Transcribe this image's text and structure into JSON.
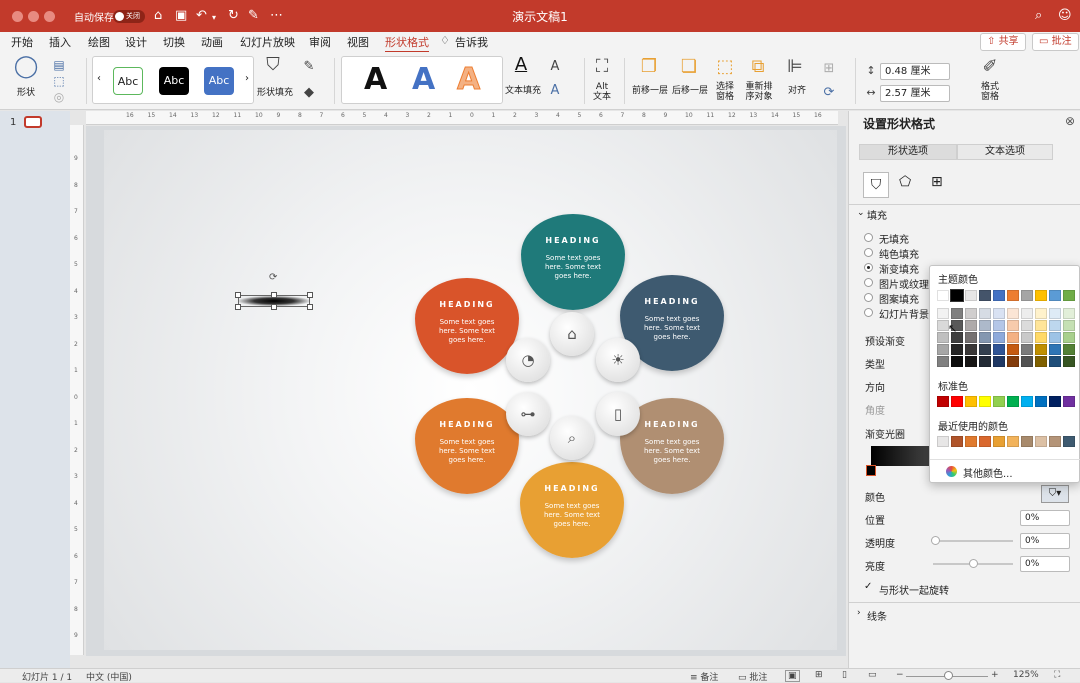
{
  "window": {
    "title": "演示文稿1",
    "autosave_label": "自动保存",
    "autosave_state": "关闭"
  },
  "tabs": [
    "开始",
    "插入",
    "绘图",
    "设计",
    "切换",
    "动画",
    "幻灯片放映",
    "审阅",
    "视图",
    "形状格式",
    "告诉我"
  ],
  "active_tab": "形状格式",
  "top_buttons": {
    "share": "共享",
    "comments": "批注"
  },
  "ribbon": {
    "shape_label": "形状",
    "style_samples": [
      "Abc",
      "Abc",
      "Abc"
    ],
    "shape_fill_label": "形状填充",
    "wordart_samples": [
      "A",
      "A",
      "A"
    ],
    "text_fill_label": "文本填充",
    "alt_text_label": "Alt\n文本",
    "bring_forward": "前移一层",
    "send_backward": "后移一层",
    "selection_pane": "选择\n窗格",
    "reorder": "重新排\n序对象",
    "align": "对齐",
    "height": "0.48 厘米",
    "width": "2.57 厘米",
    "format_pane": "格式\n窗格"
  },
  "slide_panel": {
    "number": "1"
  },
  "ruler_h": [
    "16",
    "15",
    "14",
    "13",
    "12",
    "11",
    "10",
    "9",
    "8",
    "7",
    "6",
    "5",
    "4",
    "3",
    "2",
    "1",
    "0",
    "1",
    "2",
    "3",
    "4",
    "5",
    "6",
    "7",
    "8",
    "9",
    "10",
    "11",
    "12",
    "13",
    "14",
    "15",
    "16"
  ],
  "ruler_v": [
    "9",
    "8",
    "7",
    "6",
    "5",
    "4",
    "3",
    "2",
    "1",
    "0",
    "1",
    "2",
    "3",
    "4",
    "5",
    "6",
    "7",
    "8",
    "9"
  ],
  "petals": [
    {
      "heading": "HEADING",
      "text": "Some text goes here. Some text goes here.",
      "color": "#1f7a7a",
      "icon": "house-icon"
    },
    {
      "heading": "HEADING",
      "text": "Some text goes here. Some text goes here.",
      "color": "#3e5a70",
      "icon": "lightbulb-icon"
    },
    {
      "heading": "HEADING",
      "text": "Some text goes here. Some text goes here.",
      "color": "#b08f72",
      "icon": "book-icon"
    },
    {
      "heading": "HEADING",
      "text": "Some text goes here. Some text goes here.",
      "color": "#e8a033",
      "icon": "search-icon"
    },
    {
      "heading": "HEADING",
      "text": "Some text goes here. Some text goes here.",
      "color": "#e07a2e",
      "icon": "hierarchy-icon"
    },
    {
      "heading": "HEADING",
      "text": "Some text goes here. Some text goes here.",
      "color": "#d9542a",
      "icon": "pie-chart-icon"
    }
  ],
  "format_pane": {
    "title": "设置形状格式",
    "tabs": [
      "形状选项",
      "文本选项"
    ],
    "section_fill": "填充",
    "fill_options": [
      "无填充",
      "纯色填充",
      "渐变填充",
      "图片或纹理填充",
      "图案填充",
      "幻灯片背景填充"
    ],
    "selected_fill": "渐变填充",
    "preset_gradient": "预设渐变",
    "type": "类型",
    "direction": "方向",
    "angle": "角度",
    "gradient_stops": "渐变光圈",
    "color": "颜色",
    "position": "位置",
    "position_value": "0%",
    "transparency": "透明度",
    "transparency_value": "0%",
    "brightness": "亮度",
    "brightness_value": "0%",
    "rotate_with_shape": "与形状一起旋转",
    "section_line": "线条"
  },
  "color_picker": {
    "theme_colors": "主题颜色",
    "standard_colors": "标准色",
    "recent_colors": "最近使用的颜色",
    "more_colors": "其他颜色...",
    "theme_top": [
      "#ffffff",
      "#000000",
      "#e7e6e6",
      "#44546a",
      "#4472c4",
      "#ed7d31",
      "#a5a5a5",
      "#ffc000",
      "#5b9bd5",
      "#70ad47"
    ],
    "theme_columns": [
      [
        "#f2f2f2",
        "#d9d9d9",
        "#bfbfbf",
        "#a6a6a6",
        "#808080"
      ],
      [
        "#7f7f7f",
        "#595959",
        "#404040",
        "#262626",
        "#0d0d0d"
      ],
      [
        "#d0cece",
        "#aeaaaa",
        "#757171",
        "#3a3838",
        "#171616"
      ],
      [
        "#d6dce4",
        "#adb9ca",
        "#8497b0",
        "#333f4f",
        "#222a35"
      ],
      [
        "#d9e2f3",
        "#b4c6e7",
        "#8eaadb",
        "#2f5496",
        "#1f3864"
      ],
      [
        "#fbe5d5",
        "#f7cbac",
        "#f4b183",
        "#c55a11",
        "#833c0b"
      ],
      [
        "#ededed",
        "#dbdbdb",
        "#c9c9c9",
        "#7b7b7b",
        "#525252"
      ],
      [
        "#fff2cc",
        "#ffe599",
        "#ffd966",
        "#bf8f00",
        "#7f6000"
      ],
      [
        "#deebf6",
        "#bdd7ee",
        "#9dc3e6",
        "#2e75b5",
        "#1f4e79"
      ],
      [
        "#e2efd9",
        "#c5e0b3",
        "#a8d08d",
        "#538135",
        "#375623"
      ]
    ],
    "standard": [
      "#c00000",
      "#ff0000",
      "#ffc000",
      "#ffff00",
      "#92d050",
      "#00b050",
      "#00b0f0",
      "#0070c0",
      "#002060",
      "#7030a0"
    ],
    "recent": [
      "#e7e6e6",
      "#b0542a",
      "#e07a2e",
      "#d9682e",
      "#e8a033",
      "#f2b35b",
      "#a88a6c",
      "#dcc0a4",
      "#b49478",
      "#3e5a70"
    ]
  },
  "status": {
    "slide_info": "幻灯片 1 / 1",
    "language": "中文 (中国)",
    "notes": "备注",
    "comments": "批注",
    "zoom": "125%"
  }
}
